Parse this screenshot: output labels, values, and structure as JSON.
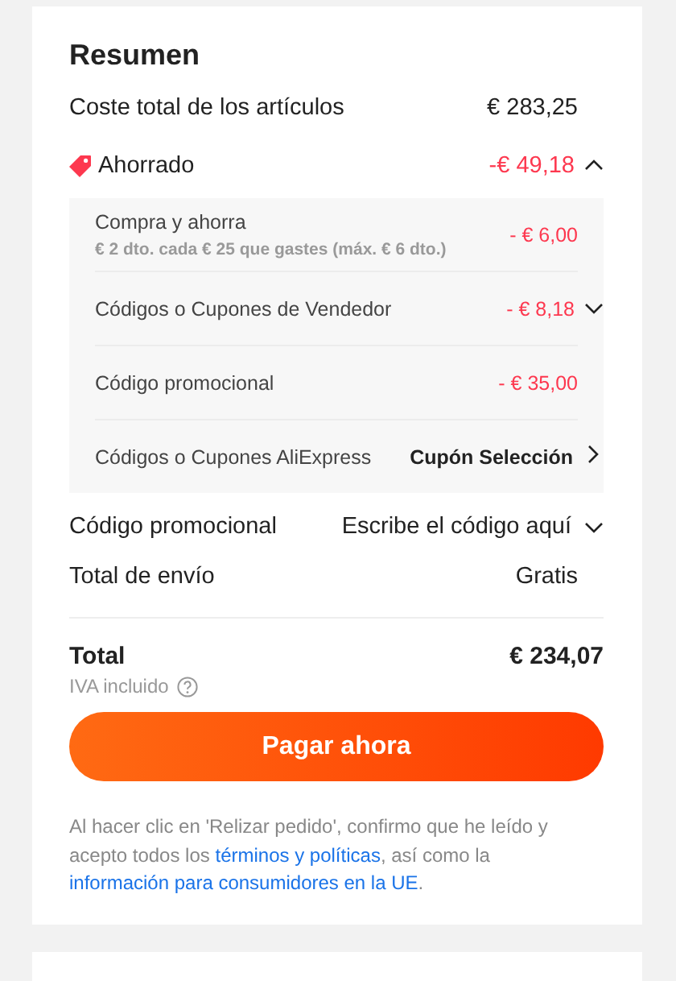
{
  "title": "Resumen",
  "items_total": {
    "label": "Coste total de los artículos",
    "value": "€ 283,25"
  },
  "savings": {
    "label": "Ahorrado",
    "value": "-€ 49,18",
    "expanded": true,
    "details": [
      {
        "kind": "plain",
        "label": "Compra y ahorra",
        "value": "- € 6,00",
        "note": "€ 2 dto. cada € 25 que gastes (máx. € 6 dto.)"
      },
      {
        "kind": "toggle",
        "label": "Códigos o Cupones de Vendedor",
        "value": "- € 8,18",
        "expanded": false
      },
      {
        "kind": "plain",
        "label": "Código promocional",
        "value": "- € 35,00"
      },
      {
        "kind": "link",
        "label": "Códigos o Cupones AliExpress",
        "value": "Cupón Selección"
      }
    ]
  },
  "promo_code": {
    "label": "Código promocional",
    "action": "Escribe el código aquí",
    "expanded": false
  },
  "shipping": {
    "label": "Total de envío",
    "value": "Gratis"
  },
  "total": {
    "label": "Total",
    "value": "€ 234,07",
    "note": "IVA incluido"
  },
  "pay_button": "Pagar ahora",
  "legal": [
    {
      "kind": "text",
      "text": "Al hacer clic en 'Relizar pedido', confirmo que he leído y acepto todos los "
    },
    {
      "kind": "link",
      "text": "términos y políticas"
    },
    {
      "kind": "text",
      "text": ", así como la "
    },
    {
      "kind": "link",
      "text": "información para consumidores en la UE"
    },
    {
      "kind": "text",
      "text": "."
    }
  ]
}
